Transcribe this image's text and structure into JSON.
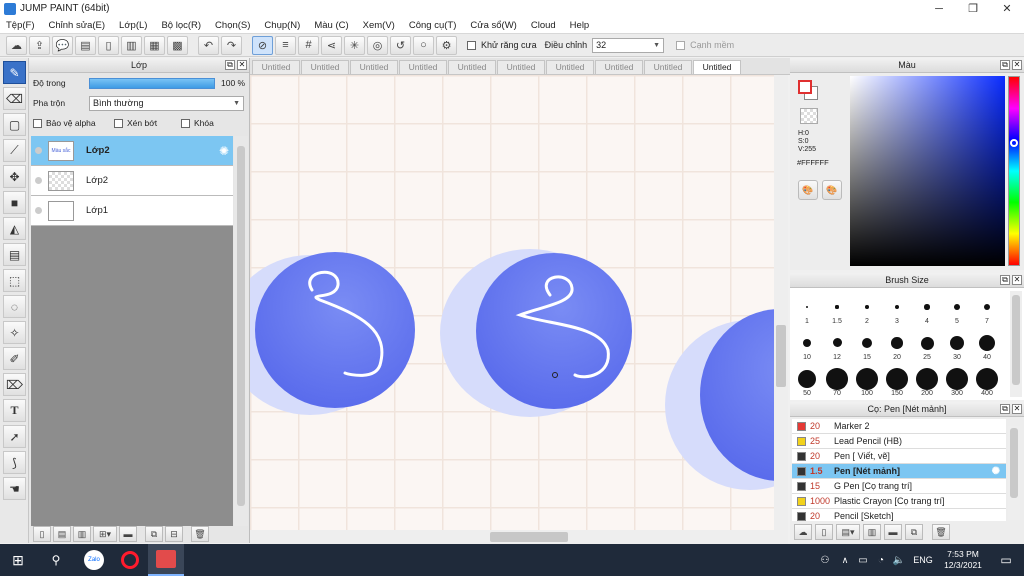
{
  "window": {
    "title": "JUMP PAINT (64bit)",
    "minimize": "─",
    "maximize": "❐",
    "close": "✕"
  },
  "menu": [
    "Tệp(F)",
    "Chỉnh sửa(E)",
    "Lớp(L)",
    "Bộ lọc(R)",
    "Chọn(S)",
    "Chụp(N)",
    "Màu (C)",
    "Xem(V)",
    "Công cụ(T)",
    "Cửa sổ(W)",
    "Cloud",
    "Help"
  ],
  "toolbar": {
    "antialias_label": "Khử răng cưa",
    "adjust_label": "Điều chỉnh",
    "adjust_value": "32",
    "edge_label": "Cạnh mềm"
  },
  "layer_panel": {
    "title": "Lớp",
    "opacity_label": "Độ trong",
    "opacity_value": "100 %",
    "opacity_percent": 100,
    "blend_label": "Pha trộn",
    "blend_value": "Bình thường",
    "protect_alpha": "Bảo vệ alpha",
    "clipping": "Xén bớt",
    "lock": "Khóa",
    "layers": [
      {
        "name": "Lớp2",
        "selected": true,
        "thumb_text": "Màu sắc"
      },
      {
        "name": "Lớp2",
        "selected": false,
        "thumb_text": ""
      },
      {
        "name": "Lớp1",
        "selected": false,
        "thumb_text": ""
      }
    ]
  },
  "tabs": [
    "Untitled",
    "Untitled",
    "Untitled",
    "Untitled",
    "Untitled",
    "Untitled",
    "Untitled",
    "Untitled",
    "Untitled",
    "Untitled"
  ],
  "active_tab_index": 9,
  "color_panel": {
    "title": "Màu",
    "h": "H:0",
    "s": "S:0",
    "v": "V:255",
    "hex": "#FFFFFF",
    "primary_color": "#ffffff",
    "primary_border": "#e03030"
  },
  "brush_size_panel": {
    "title": "Brush Size",
    "sizes": [
      "1",
      "1.5",
      "2",
      "3",
      "4",
      "5",
      "7",
      "10",
      "12",
      "15",
      "20",
      "25",
      "30",
      "40",
      "50",
      "70",
      "100",
      "150",
      "200",
      "300",
      "400"
    ]
  },
  "tool_panel": {
    "title": "Cọ: Pen [Nét mảnh]",
    "tools": [
      {
        "size": "20",
        "name": "Marker 2",
        "color": "#e53935",
        "selected": false
      },
      {
        "size": "25",
        "name": "Lead Pencil (HB)",
        "color": "#f2d21b",
        "selected": false
      },
      {
        "size": "20",
        "name": "Pen [ Viết, vẽ]",
        "color": "#333333",
        "selected": false
      },
      {
        "size": "1.5",
        "name": "Pen [Nét mảnh]",
        "color": "#333333",
        "selected": true
      },
      {
        "size": "15",
        "name": "G Pen [Cọ trang trí]",
        "color": "#333333",
        "selected": false
      },
      {
        "size": "1000",
        "name": "Plastic Crayon [Cọ trang trí]",
        "color": "#f2d21b",
        "selected": false
      },
      {
        "size": "20",
        "name": "Pencil [Sketch]",
        "color": "#333333",
        "selected": false
      }
    ]
  },
  "taskbar": {
    "zalo": "Zalo",
    "lang": "ENG",
    "time": "7:53 PM",
    "date": "12/3/2021"
  },
  "colors": {
    "accent": "#7cc6f2",
    "ball": "#6d7ff0",
    "ball_shadow": "#d6dcfb"
  }
}
